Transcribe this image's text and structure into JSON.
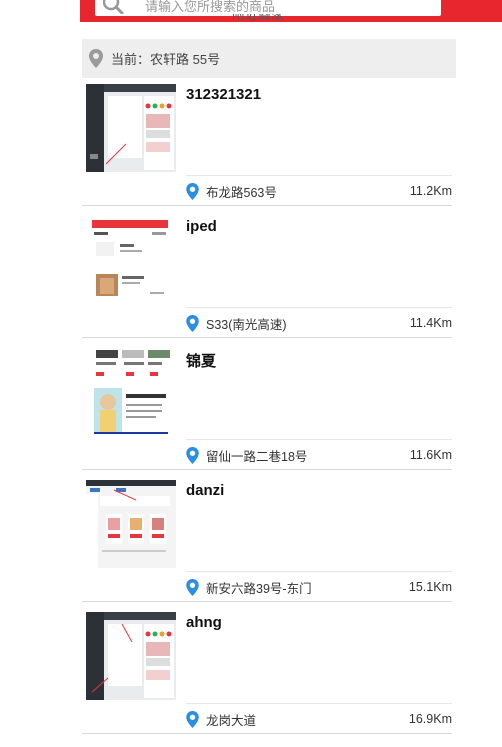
{
  "search": {
    "placeholder": "请输入您所搜索的商品"
  },
  "header": {
    "cut_label": "附近商家"
  },
  "location": {
    "label": "当前：农轩路 55号"
  },
  "colors": {
    "brand_red": "#e8262d",
    "pin_blue": "#2a8fe0",
    "pin_gray": "#9a9a9a"
  },
  "stores": [
    {
      "name": "312321321",
      "address": "布龙路563号",
      "distance": "11.2Km",
      "thumbnail": "admin-panel-screenshot"
    },
    {
      "name": "iped",
      "address": "S33(南光高速)",
      "distance": "11.4Km",
      "thumbnail": "shop-list-screenshot"
    },
    {
      "name": "锦夏",
      "address": "留仙一路二巷18号",
      "distance": "11.6Km",
      "thumbnail": "fashion-banner-screenshot"
    },
    {
      "name": "danzi",
      "address": "新安六路39号-东门",
      "distance": "15.1Km",
      "thumbnail": "template-editor-screenshot"
    },
    {
      "name": "ahng",
      "address": "龙岗大道",
      "distance": "16.9Km",
      "thumbnail": "admin-panel-screenshot"
    }
  ]
}
